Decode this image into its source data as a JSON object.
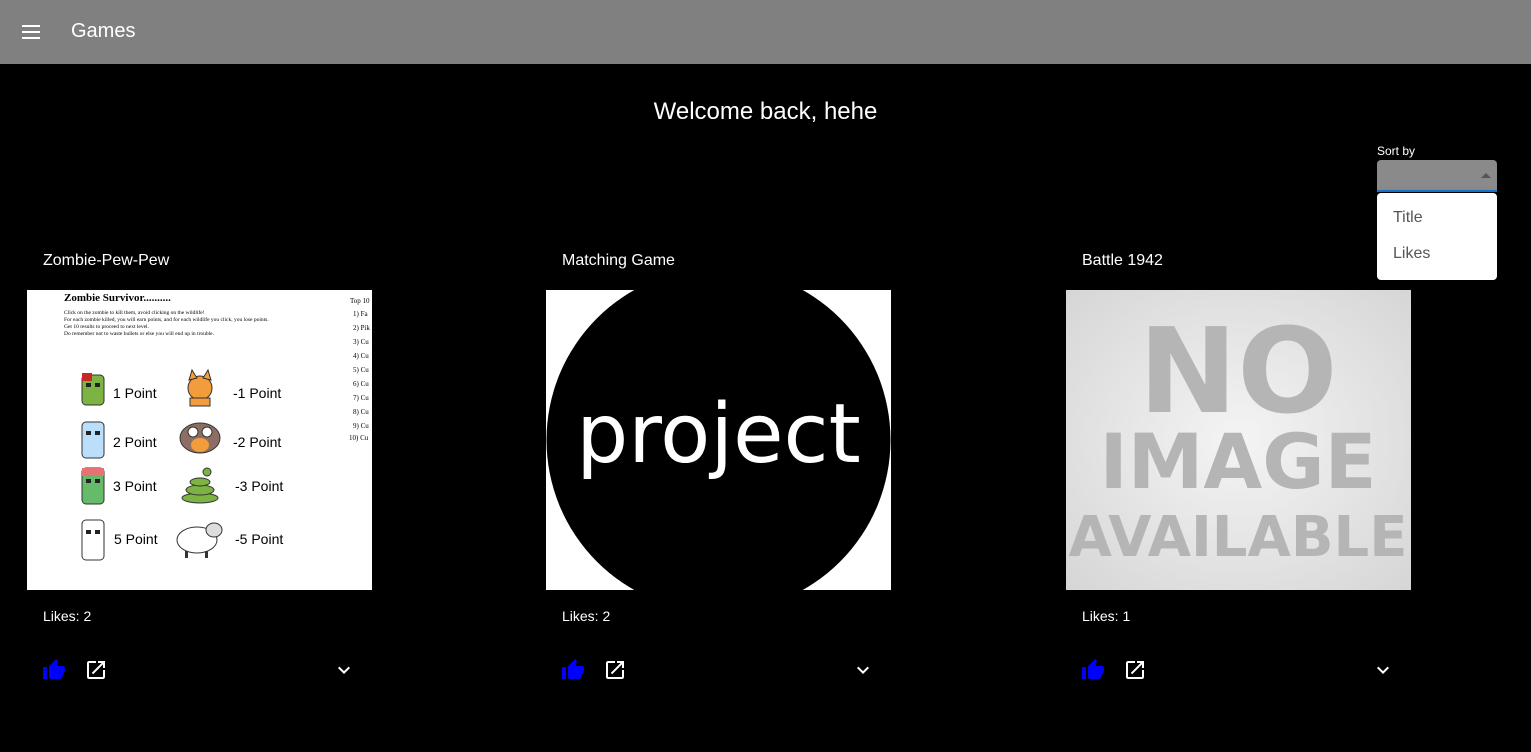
{
  "appbar": {
    "title": "Games",
    "menu_icon": "hamburger-menu-icon",
    "color": "#808080"
  },
  "welcome": "Welcome back, hehe",
  "sort": {
    "label": "Sort by",
    "value": "",
    "options": [
      "Title",
      "Likes"
    ]
  },
  "games": [
    {
      "title": "Zombie-Pew-Pew",
      "likes": "Likes: 2",
      "image": {
        "heading": "Zombie Survivor..........",
        "instructions": [
          "Click on the zombie to kill them, avoid clicking on the wildlife!",
          "For each zombie killed, you will earn points, and for each wildlife you click, you lose points.",
          "Get 10 results to proceed to next level.",
          "Do remember not to waste bullets or else you will end up in trouble."
        ],
        "top_label": "Top 10",
        "top_rows": [
          "1) Fa",
          "2) Pik",
          "3) Cu",
          "4) Cu",
          "5) Cu",
          "6) Cu",
          "7) Cu",
          "8) Cu",
          "9) Cu",
          "10) Cu"
        ],
        "points": [
          {
            "good": "1 Point",
            "bad": "-1 Point"
          },
          {
            "good": "2 Point",
            "bad": "-2 Point"
          },
          {
            "good": "3 Point",
            "bad": "-3 Point"
          },
          {
            "good": "5 Point",
            "bad": "-5 Point"
          }
        ]
      }
    },
    {
      "title": "Matching Game",
      "likes": "Likes: 2",
      "image": {
        "text": "project"
      }
    },
    {
      "title": "Battle 1942",
      "likes": "Likes: 1",
      "image": {
        "line1": "NO",
        "line2": "IMAGE",
        "line3": "AVAILABLE"
      }
    }
  ],
  "colors": {
    "like_icon": "#0000ff",
    "accent": "#1976d2"
  },
  "icons": {
    "like": "thumb-up-icon",
    "open": "open-in-new-icon",
    "expand": "expand-more-icon"
  }
}
